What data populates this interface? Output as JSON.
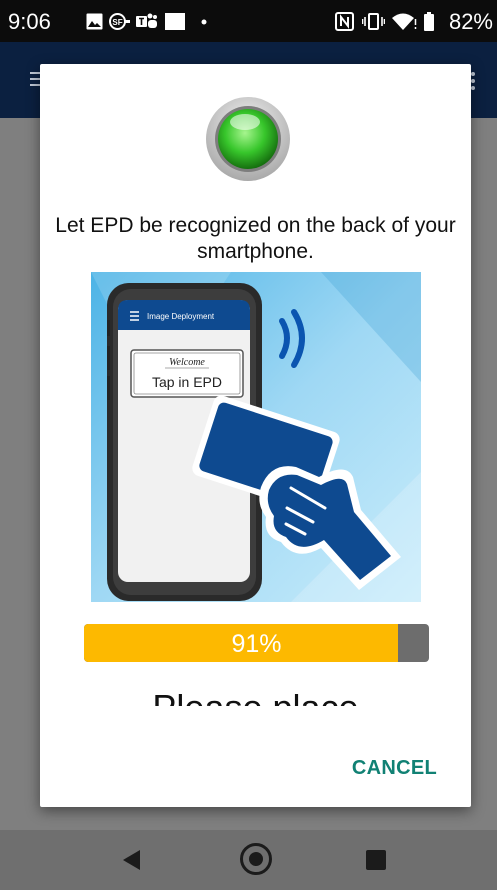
{
  "status_bar": {
    "time": "9:06",
    "battery_percent": "82%",
    "icons": [
      "image-icon",
      "sf-app-icon",
      "teams-icon",
      "square-notification-icon",
      "dot-icon",
      "nfc-icon",
      "vibrate-icon",
      "wifi-icon",
      "battery-icon"
    ]
  },
  "dialog": {
    "status_led_color": "#37c62b",
    "instruction": "Let EPD be recognized on the back of your smartphone.",
    "illustration": {
      "app_title": "Image Deployment",
      "welcome_text": "Welcome",
      "tap_text": "Tap in EPD"
    },
    "progress": {
      "value": 0.91,
      "label": "91%",
      "fill_color": "#fdb900"
    },
    "partial_text": "Please place",
    "cancel_label": "CANCEL"
  },
  "colors": {
    "app_bar": "#0b2040",
    "accent": "#118174"
  }
}
